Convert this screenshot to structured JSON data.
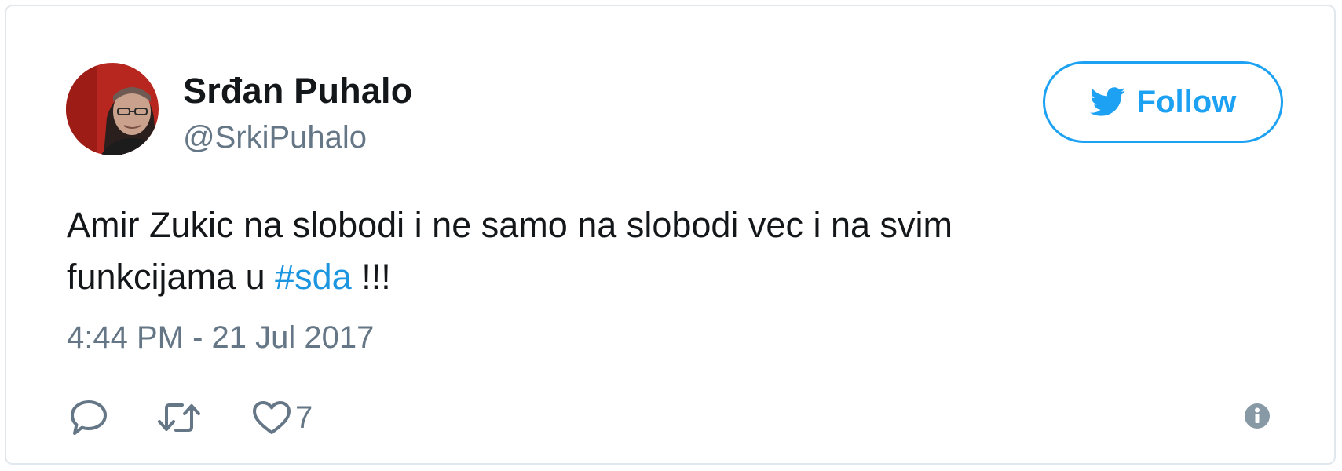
{
  "tweet": {
    "author": {
      "name": "Srđan Puhalo",
      "handle": "@SrkiPuhalo"
    },
    "follow_button": {
      "label": "Follow",
      "icon": "twitter-bird-icon"
    },
    "text": {
      "line1": "Amir Zukic na slobodi i ne samo na slobodi vec i na svim",
      "line2_prefix": "funkcijama u ",
      "hashtag": "#sda",
      "line2_suffix": " !!!"
    },
    "timestamp": "4:44 PM - 21 Jul 2017",
    "actions": {
      "reply_icon": "reply-icon",
      "retweet_icon": "retweet-icon",
      "like_icon": "heart-icon",
      "like_count": "7",
      "info_icon": "info-icon"
    }
  },
  "colors": {
    "accent": "#1da1f2",
    "hashtag": "#1b95e0",
    "secondary_text": "#657786",
    "primary_text": "#14171a",
    "border": "#e1e8ed"
  }
}
